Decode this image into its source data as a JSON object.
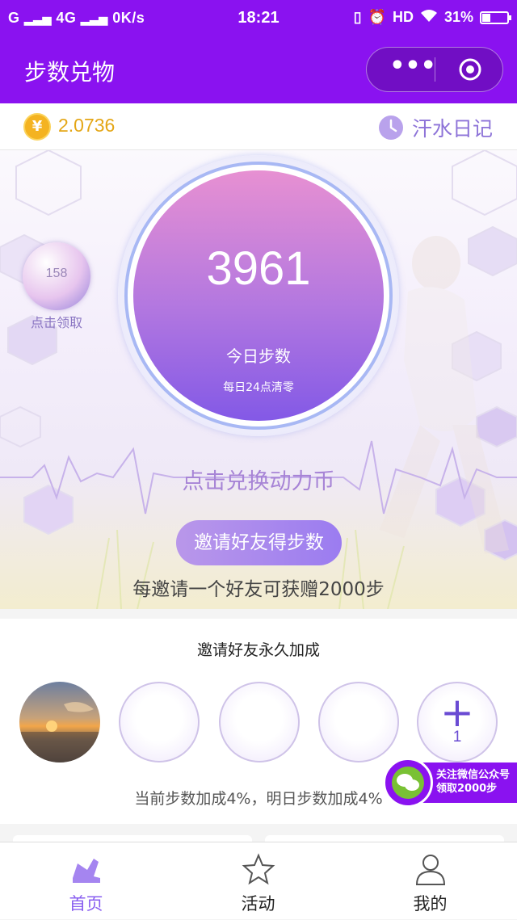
{
  "status_bar": {
    "left": "G",
    "network": "4G",
    "speed": "0K/s",
    "time": "18:21",
    "hd": "HD",
    "battery": "31%"
  },
  "nav": {
    "title": "步数兑物",
    "more": "•••"
  },
  "info": {
    "coin_icon_text": "¥",
    "balance": "2.0736",
    "diary_label": "汗水日记"
  },
  "hero": {
    "steps": "3961",
    "steps_label": "今日步数",
    "steps_sub": "每日24点清零",
    "bubble_value": "158",
    "bubble_label": "点击领取",
    "exchange_text": "点击兑换动力币",
    "invite_button": "邀请好友得步数",
    "invite_desc": "每邀请一个好友可获赠2000步"
  },
  "friends": {
    "title": "邀请好友永久加成",
    "add_label": "+",
    "add_count": "1",
    "bonus_text": "当前步数加成4%，明日步数加成4%"
  },
  "wechat_float": {
    "line1": "关注微信公众号",
    "line2": "领取2000步"
  },
  "tabs": [
    {
      "label": "首页",
      "icon": "shoe-icon",
      "active": true
    },
    {
      "label": "活动",
      "icon": "star-icon",
      "active": false
    },
    {
      "label": "我的",
      "icon": "user-icon",
      "active": false
    }
  ],
  "colors": {
    "brand": "#8a12f0",
    "accent": "#8a5ff0",
    "coin": "#f4b321"
  }
}
